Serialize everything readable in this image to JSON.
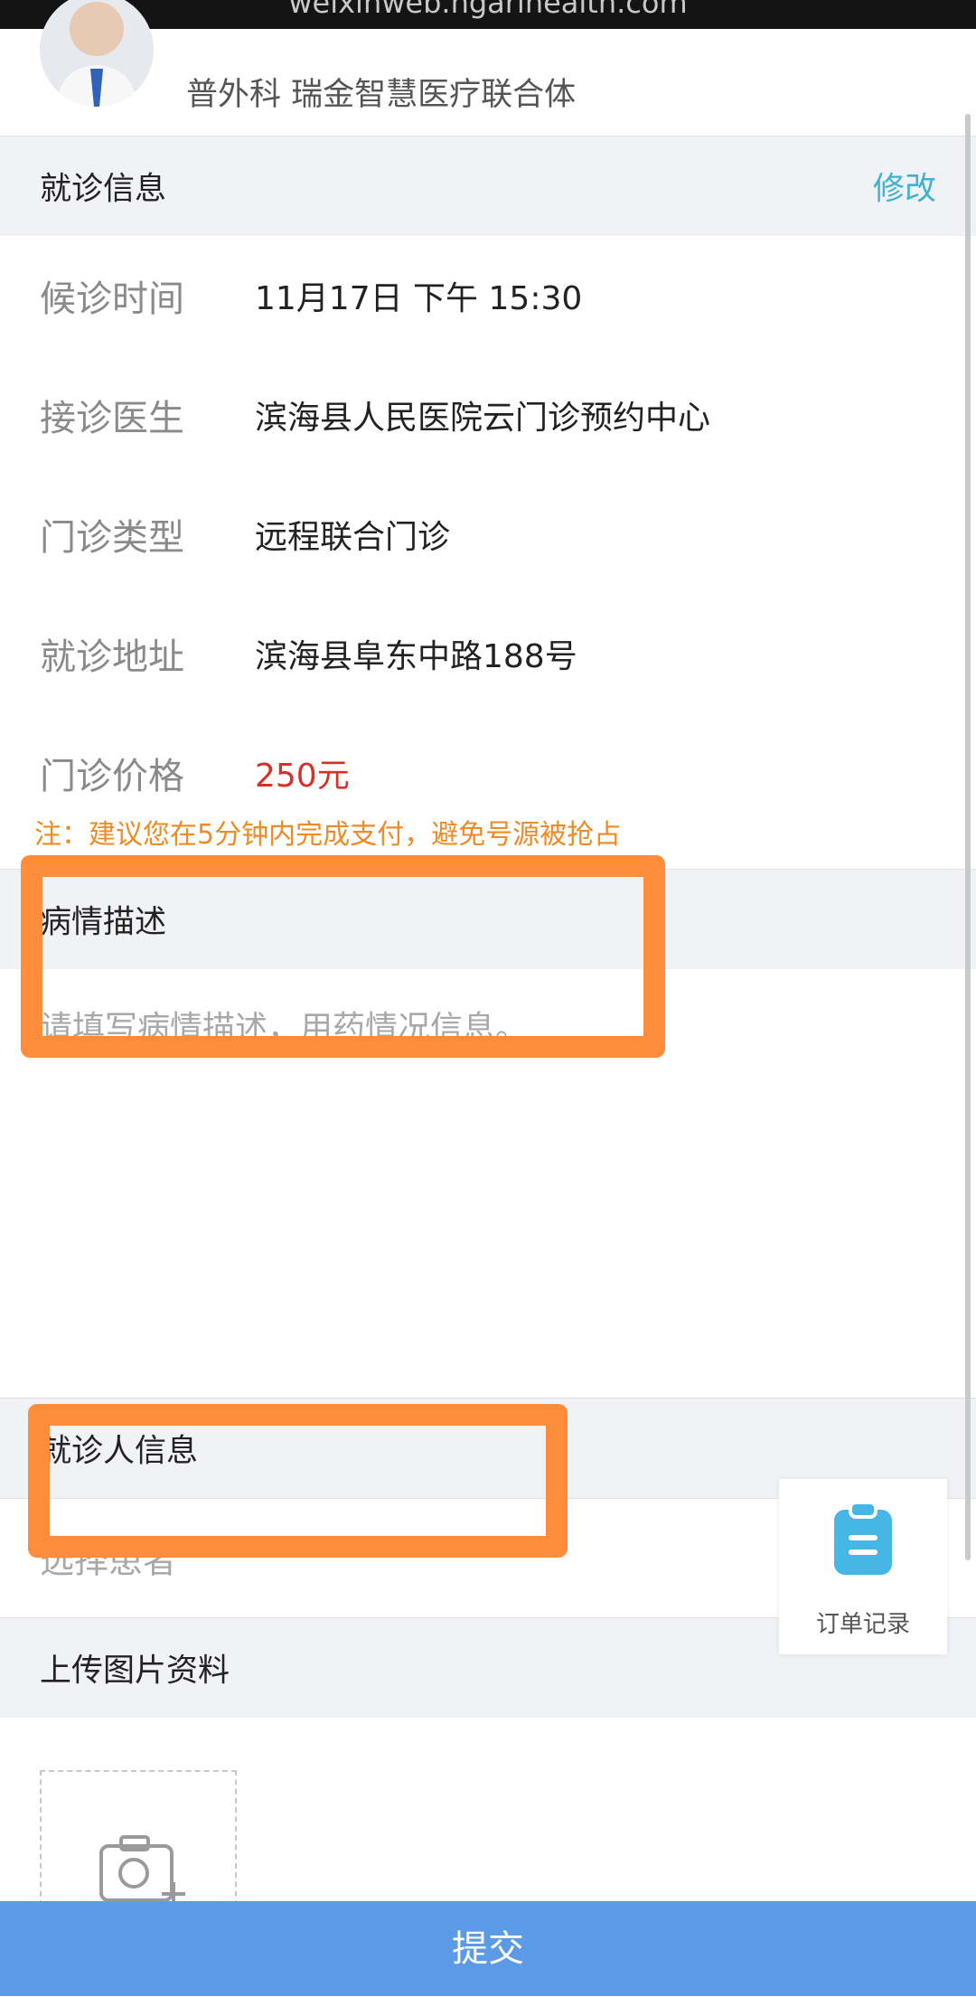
{
  "browser": {
    "url_text": "weixinweb.ngarihealth.com"
  },
  "doctor": {
    "department_line": "普外科   瑞金智慧医疗联合体"
  },
  "visit_info": {
    "section_title": "就诊信息",
    "edit_label": "修改",
    "rows": [
      {
        "label": "候诊时间",
        "value": "11月17日 下午 15:30"
      },
      {
        "label": "接诊医生",
        "value": "滨海县人民医院云门诊预约中心"
      },
      {
        "label": "门诊类型",
        "value": "远程联合门诊"
      },
      {
        "label": "就诊地址",
        "value": "滨海县阜东中路188号"
      },
      {
        "label": "门诊价格",
        "value": "250元"
      }
    ],
    "note": "注：建议您在5分钟内完成支付，避免号源被抢占"
  },
  "condition": {
    "section_title": "病情描述",
    "placeholder": "请填写病情描述，用药情况信息。"
  },
  "patient": {
    "section_title": "就诊人信息",
    "select_placeholder": "选择患者"
  },
  "upload": {
    "section_title": "上传图片资料"
  },
  "floating_button": {
    "label": "订单记录"
  },
  "submit": {
    "label": "提交"
  },
  "colors": {
    "accent": "#3fb2d1",
    "price": "#d6302a",
    "note": "#f08a24",
    "submit_bg": "#5b9be6",
    "annotation": "#ff8c3a"
  },
  "icons": {
    "avatar": "doctor-avatar",
    "order": "clipboard-icon",
    "upload": "camera-plus-icon"
  }
}
